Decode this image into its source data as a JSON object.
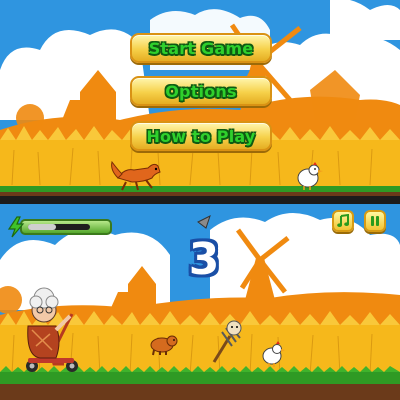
{
  "menu": {
    "start_label": "Start Game",
    "options_label": "Options",
    "howto_label": "How to Play"
  },
  "hud": {
    "countdown": "3",
    "energy_level": 0.45,
    "music_icon": "music-note-icon",
    "pause_icon": "pause-icon"
  },
  "colors": {
    "sky": "#2f95e0",
    "cloud": "#ffffff",
    "silhouette": "#f08a10",
    "wheat": "#f6b81b",
    "grass": "#2f9a24",
    "dirt": "#6b3a1a",
    "button_text": "#2fd02c",
    "button_fill": "#f6d14a",
    "countdown_text": "#ffffff",
    "countdown_outline": "#1a4fa6"
  }
}
